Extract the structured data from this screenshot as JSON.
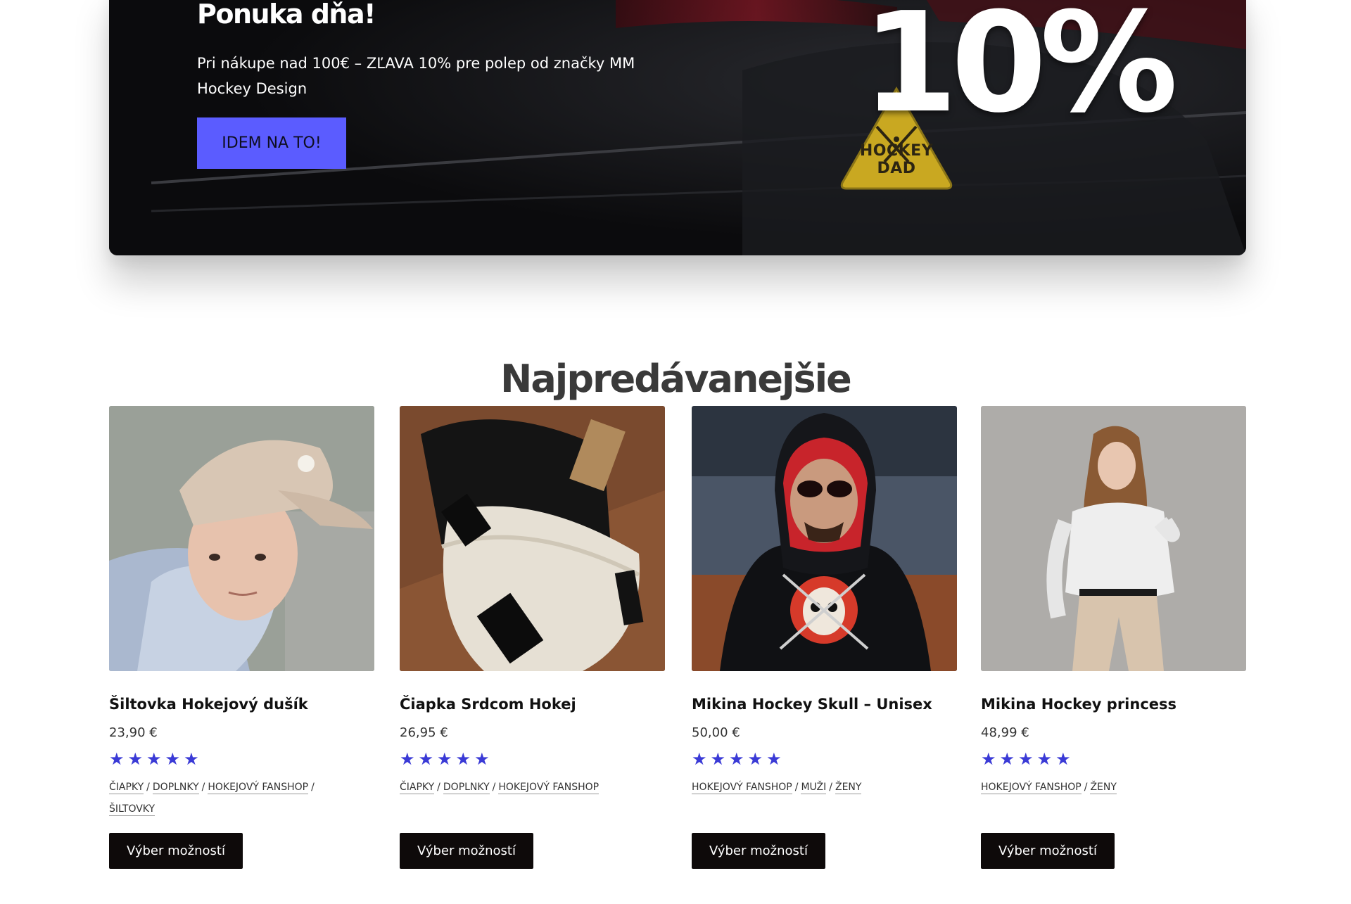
{
  "promo": {
    "title": "Ponuka dňa!",
    "text": "Pri nákupe nad 100€ – ZĽAVA 10% pre polep od značky MM Hockey Design",
    "button_label": "IDEM NA TO!",
    "percent": "10%",
    "sticker_text": "HOCKEY DAD",
    "button_color": "#5b5cff"
  },
  "bestsellers": {
    "title": "Najpredávanejšie",
    "products": [
      {
        "name": "Šiltovka Hokejový dušík",
        "price": "23,90 €",
        "rating": 5,
        "categories": [
          "ČIAPKY",
          "DOPLNKY",
          "HOKEJOVÝ FANSHOP",
          "ŠILTOVKY"
        ],
        "button_label": "Výber možností"
      },
      {
        "name": "Čiapka Srdcom Hokej",
        "price": "26,95 €",
        "rating": 5,
        "categories": [
          "ČIAPKY",
          "DOPLNKY",
          "HOKEJOVÝ FANSHOP"
        ],
        "button_label": "Výber možností"
      },
      {
        "name": "Mikina Hockey Skull – Unisex",
        "price": "50,00 €",
        "rating": 5,
        "categories": [
          "HOKEJOVÝ FANSHOP",
          "MUŽI",
          "ŽENY"
        ],
        "button_label": "Výber možností"
      },
      {
        "name": "Mikina Hockey princess",
        "price": "48,99 €",
        "rating": 5,
        "categories": [
          "HOKEJOVÝ FANSHOP",
          "ŽENY"
        ],
        "button_label": "Výber možností"
      }
    ]
  },
  "colors": {
    "star": "#3a3ad6",
    "button_dark": "#0e0a0a"
  }
}
